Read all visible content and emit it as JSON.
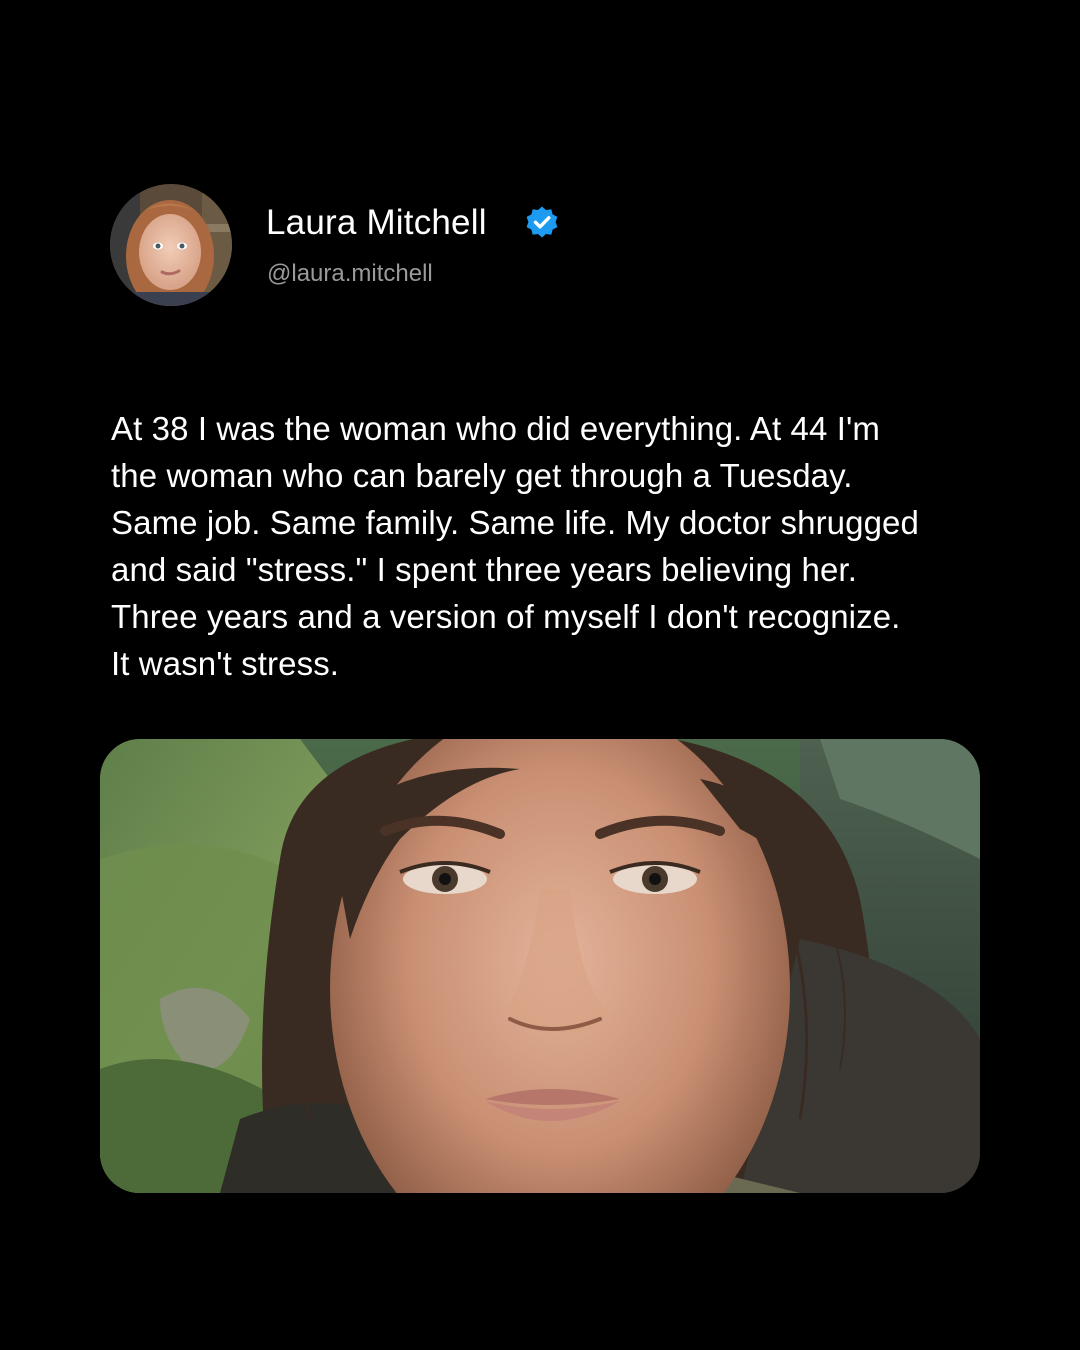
{
  "author": {
    "name": "Laura Mitchell",
    "handle": "@laura.mitchell",
    "verified": true,
    "avatar_icon": "profile-photo",
    "verified_icon": "verified-badge-icon",
    "verified_color": "#1d9bf0"
  },
  "post": {
    "lines": [
      "At 38 I was the woman who did everything. At 44 I'm",
      "the woman who can barely get through a Tuesday.",
      "Same job. Same family. Same life. My doctor shrugged",
      "and said \"stress.\" I spent three years believing her.",
      "Three years and a version of myself I don't recognize.",
      "It wasn't stress."
    ],
    "photo_icon": "selfie-photo"
  },
  "colors": {
    "background": "#000000",
    "text": "#ffffff",
    "handle": "#9a9a9a"
  }
}
